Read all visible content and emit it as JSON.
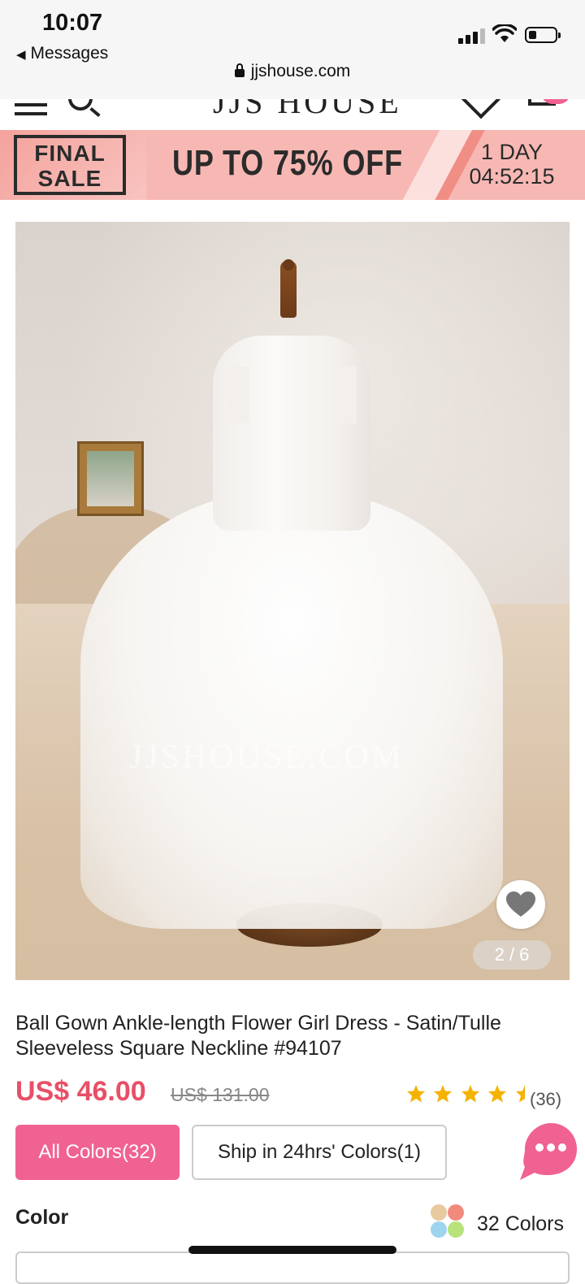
{
  "status_bar": {
    "time": "10:07",
    "back_app": "Messages",
    "url": "jjshouse.com"
  },
  "site_header": {
    "logo": "JJS HOUSE",
    "icons": [
      "menu-icon",
      "search-icon",
      "heart-icon",
      "cart-icon"
    ]
  },
  "promo": {
    "badge_line1": "FINAL",
    "badge_line2": "SALE",
    "headline": "UP TO 75% OFF",
    "countdown_days": "1 DAY",
    "countdown_time": "04:52:15",
    "bg_color": "#f7b8b4"
  },
  "gallery": {
    "watermark": "JJSHOUSE.COM",
    "pager": "2 / 6"
  },
  "product": {
    "title": "Ball Gown Ankle-length Flower Girl Dress - Satin/Tulle Sleeveless Square Neckline #94107",
    "price": "US$ 46.00",
    "old_price": "US$ 131.00",
    "rating": 4.5,
    "review_count": "(36)",
    "accent_color": "#e84f67"
  },
  "filters": {
    "all_colors": "All Colors(32)",
    "ship_colors": "Ship in 24hrs' Colors(1)"
  },
  "color_section": {
    "label": "Color",
    "count": "32 Colors"
  }
}
